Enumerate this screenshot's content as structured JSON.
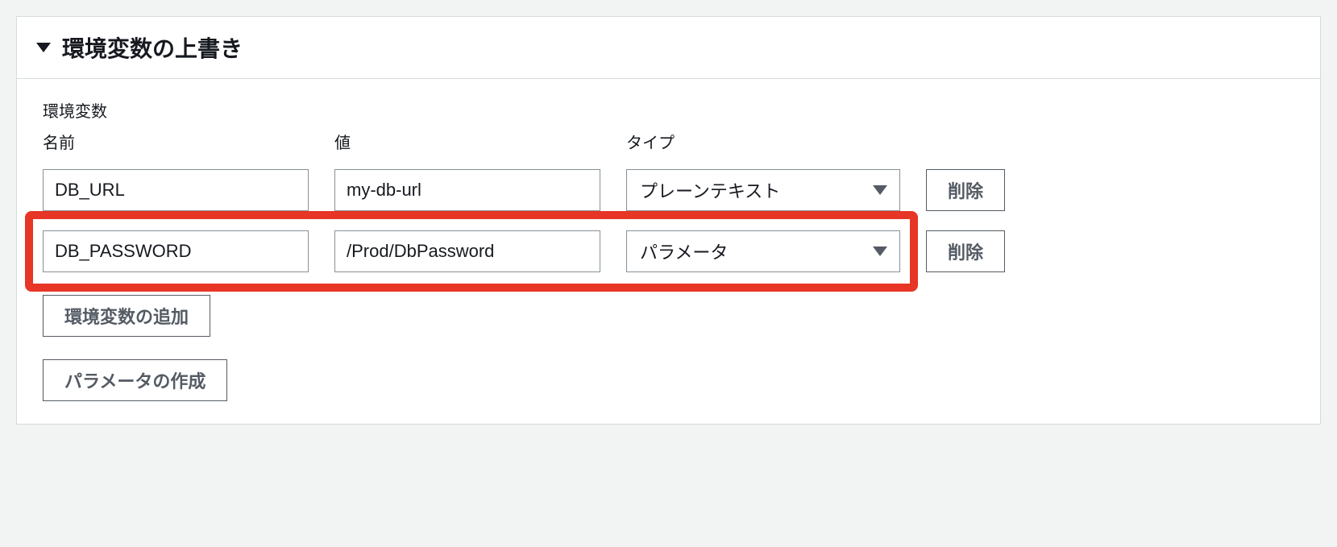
{
  "panel": {
    "title": "環境変数の上書き",
    "section_label": "環境変数",
    "columns": {
      "name": "名前",
      "value": "値",
      "type": "タイプ"
    },
    "rows": [
      {
        "name": "DB_URL",
        "value": "my-db-url",
        "type": "プレーンテキスト",
        "delete_label": "削除",
        "highlighted": false
      },
      {
        "name": "DB_PASSWORD",
        "value": "/Prod/DbPassword",
        "type": "パラメータ",
        "delete_label": "削除",
        "highlighted": true
      }
    ],
    "add_button": "環境変数の追加",
    "create_param_button": "パラメータの作成"
  },
  "colors": {
    "highlight": "#e2392a",
    "border": "#879196",
    "text": "#16191f",
    "button_text": "#545b64"
  }
}
